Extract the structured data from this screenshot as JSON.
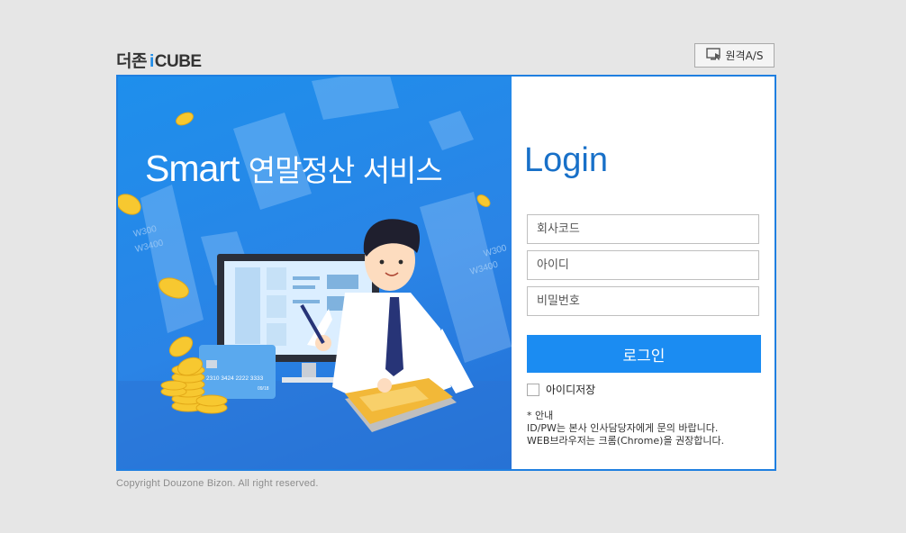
{
  "brand": {
    "prefix": "더존",
    "i": "i",
    "suffix": "CUBE"
  },
  "remote_support": {
    "label": "원격A/S",
    "icon": "remote-monitor-icon"
  },
  "hero": {
    "title_en": "Smart",
    "title_ko": "연말정산 서비스",
    "card_number": "2310 3424 2222 3333",
    "card_meta": "09/18",
    "receipt_amounts": [
      "W300",
      "W3400",
      "W300",
      "W3400"
    ]
  },
  "login": {
    "title": "Login",
    "company_code_placeholder": "회사코드",
    "id_placeholder": "아이디",
    "password_placeholder": "비밀번호",
    "button_label": "로그인",
    "save_id_label": "아이디저장",
    "notice_title": "* 안내",
    "notice_line1": "ID/PW는 본사 인사담당자에게 문의 바랍니다.",
    "notice_line2": "WEB브라우저는 크롬(Chrome)을 권장합니다."
  },
  "footer": {
    "copyright": "Copyright Douzone Bizon. All right reserved."
  },
  "colors": {
    "accent": "#1b8cf2",
    "frame": "#1f7fe0",
    "title": "#1870c8"
  }
}
